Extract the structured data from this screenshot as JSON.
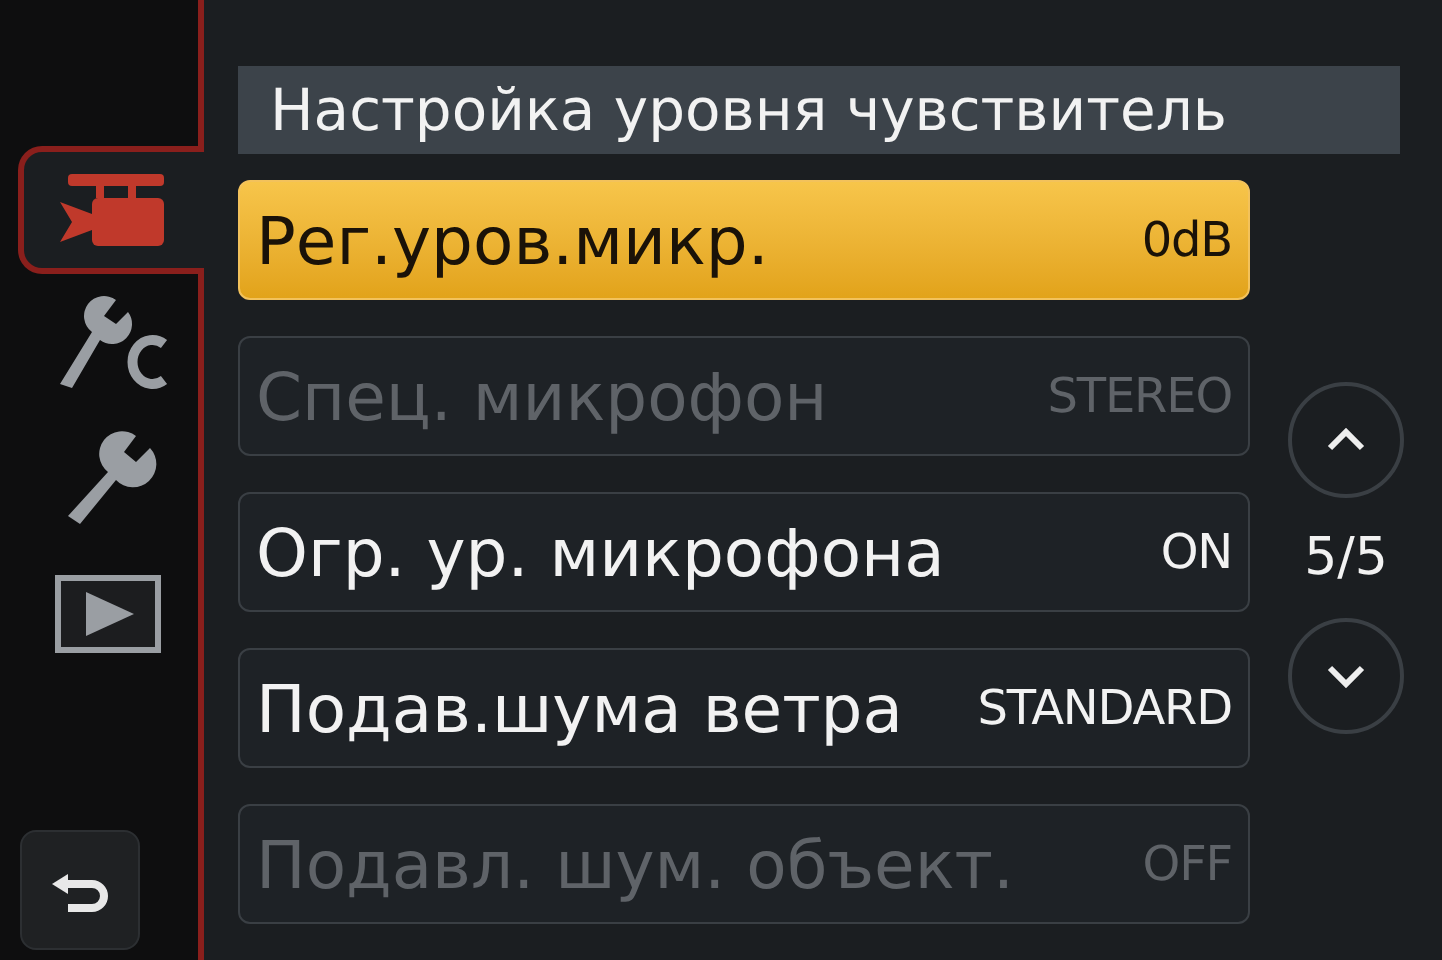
{
  "sidebar": {
    "tabs": [
      {
        "kind": "video",
        "selected": true
      },
      {
        "kind": "custom",
        "selected": false
      },
      {
        "kind": "setup",
        "selected": false
      },
      {
        "kind": "playback",
        "selected": false
      }
    ]
  },
  "title": "Настройка уровня чувствитель",
  "items": [
    {
      "label": "Рег.уров.микр.",
      "value": "0dB",
      "selected": true,
      "disabled": false
    },
    {
      "label": "Спец. микрофон",
      "value": "STEREO",
      "selected": false,
      "disabled": true
    },
    {
      "label": "Огр. ур. микрофона",
      "value": "ON",
      "selected": false,
      "disabled": false
    },
    {
      "label": "Подав.шума ветра",
      "value": "STANDARD",
      "selected": false,
      "disabled": false
    },
    {
      "label": "Подавл. шум. объект.",
      "value": "OFF",
      "selected": false,
      "disabled": true
    }
  ],
  "pager": "5/5"
}
